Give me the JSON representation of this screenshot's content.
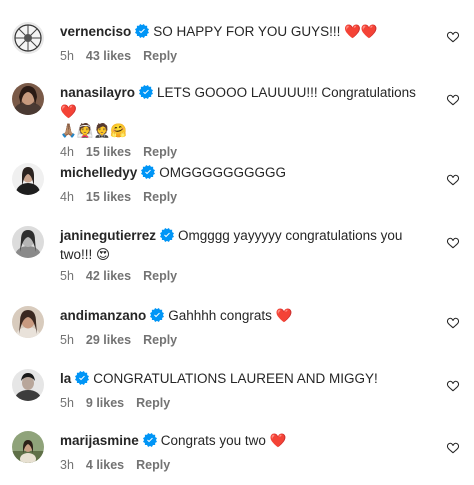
{
  "comments": [
    {
      "username": "vernenciso",
      "verified": true,
      "text": "SO HAPPY FOR YOU GUYS!!! ❤️❤️",
      "time": "5h",
      "likes": "43 likes",
      "reply": "Reply"
    },
    {
      "username": "nanasilayro",
      "verified": true,
      "text": "LETS GOOOO LAUUUU!!! Congratulations ❤️",
      "second_line": "🙏🏽👰🤵🤗",
      "time": "4h",
      "likes": "15 likes",
      "reply": "Reply"
    },
    {
      "username": "michelledyy",
      "verified": true,
      "text": "OMGGGGGGGGGG",
      "time": "4h",
      "likes": "15 likes",
      "reply": "Reply"
    },
    {
      "username": "janinegutierrez",
      "verified": true,
      "text": "Omgggg yayyyyy congratulations you",
      "second_line": "two!!! 😍",
      "time": "5h",
      "likes": "42 likes",
      "reply": "Reply"
    },
    {
      "username": "andimanzano",
      "verified": true,
      "text": "Gahhhh congrats ❤️",
      "time": "5h",
      "likes": "29 likes",
      "reply": "Reply"
    },
    {
      "username": "la",
      "verified": true,
      "text": "CONGRATULATIONS LAUREEN AND MIGGY!",
      "time": "5h",
      "likes": "9 likes",
      "reply": "Reply"
    },
    {
      "username": "marijasmine",
      "verified": true,
      "text": "Congrats you two ❤️",
      "time": "3h",
      "likes": "4 likes",
      "reply": "Reply"
    }
  ],
  "colors": {
    "text": "#262626",
    "secondary": "#737373",
    "verified_blue": "#0095F6",
    "heart_red": "#ED1C24"
  },
  "icons": {
    "verified": "verified-badge-icon",
    "like": "heart-outline-icon"
  }
}
